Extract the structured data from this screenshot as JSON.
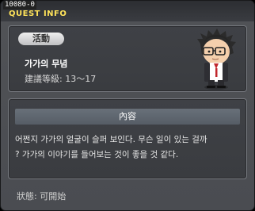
{
  "window": {
    "quest_id": "10080-0",
    "title": "QUEST INFO"
  },
  "quest": {
    "category_badge": "活動",
    "name": "가가의 무념",
    "level_label": "建議等級:",
    "level_range": "13～17",
    "npc_icon": "npc-portrait-icon"
  },
  "content": {
    "header": "內容",
    "lines": [
      "어쩐지 가가의 얼굴이 슬퍼 보인다. 무슨 일이 있는 걸까",
      "? 가가의 이야기를 들어보는 것이 좋을 것 같다."
    ]
  },
  "status": {
    "label": "狀態:",
    "value": "可開始"
  },
  "colors": {
    "title": "#ffe35a",
    "background": "#505256",
    "header_bar": "#5f6770"
  }
}
